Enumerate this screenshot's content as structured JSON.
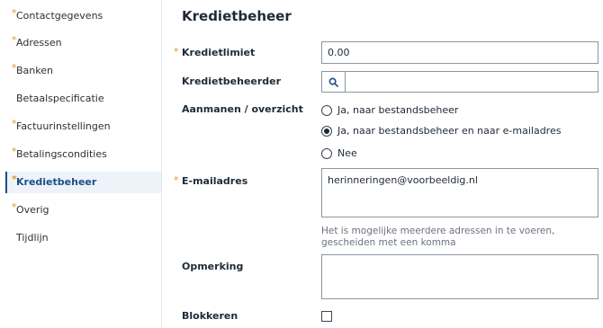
{
  "sidebar": {
    "items": [
      {
        "label": "Contactgegevens",
        "required": true
      },
      {
        "label": "Adressen",
        "required": true
      },
      {
        "label": "Banken",
        "required": true
      },
      {
        "label": "Betaalspecificatie",
        "required": false
      },
      {
        "label": "Factuurinstellingen",
        "required": true
      },
      {
        "label": "Betalingscondities",
        "required": true
      },
      {
        "label": "Kredietbeheer",
        "required": true,
        "active": true
      },
      {
        "label": "Overig",
        "required": true
      },
      {
        "label": "Tijdlijn",
        "required": false
      }
    ]
  },
  "main": {
    "title": "Kredietbeheer",
    "required_marker": "*",
    "kredietlimiet": {
      "label": "Kredietlimiet",
      "value": "0.00"
    },
    "kredietbeheerder": {
      "label": "Kredietbeheerder",
      "value": ""
    },
    "aanmanen": {
      "label": "Aanmanen / overzicht",
      "options": [
        {
          "label": "Ja, naar bestandsbeheer",
          "checked": false
        },
        {
          "label": "Ja, naar bestandsbeheer en naar e-mailadres",
          "checked": true
        },
        {
          "label": "Nee",
          "checked": false
        }
      ]
    },
    "email": {
      "label": "E-mailadres",
      "value": "herinneringen@voorbeeldig.nl",
      "hint": "Het is mogelijke meerdere adressen in te voeren, gescheiden met een komma"
    },
    "opmerking": {
      "label": "Opmerking",
      "value": ""
    },
    "blokkeren": {
      "label": "Blokkeren",
      "checked": false
    }
  },
  "colors": {
    "accent": "#1b4f8a",
    "required": "#e09a1a",
    "active_bg": "#eef3f9",
    "border": "#8b96a3"
  },
  "icons": {
    "lookup": "search-icon"
  }
}
